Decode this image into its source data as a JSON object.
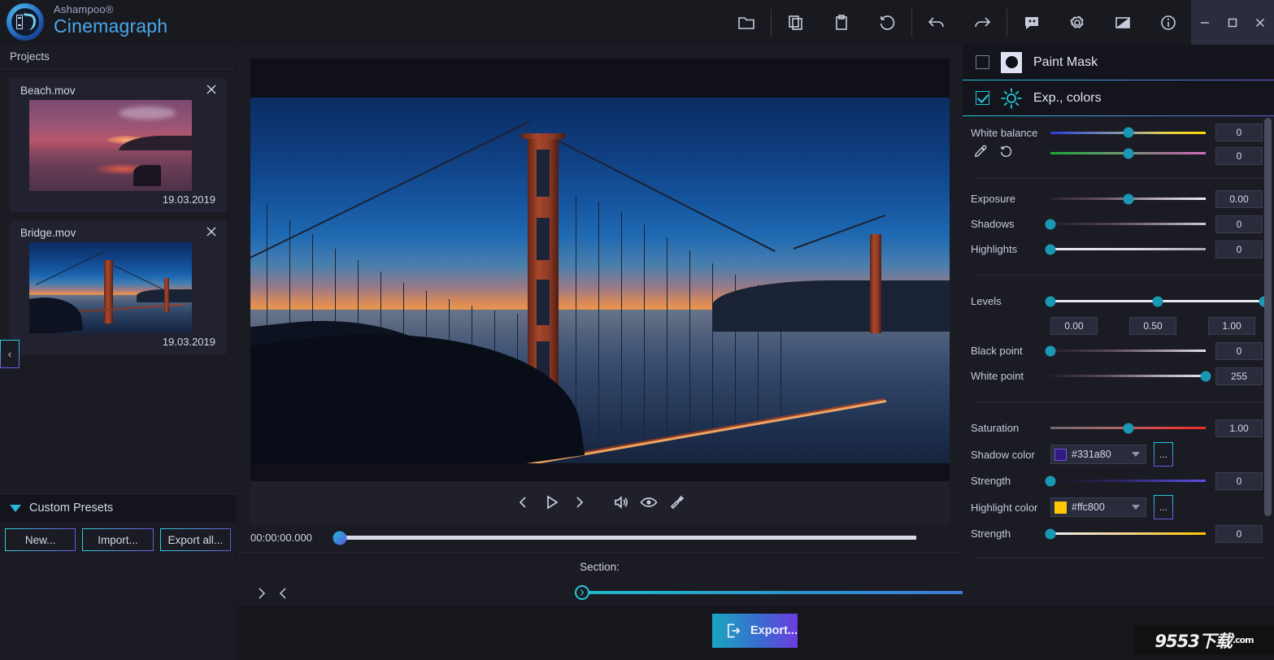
{
  "app": {
    "brand_top": "Ashampoo®",
    "brand_main": "Cinemagraph",
    "logo_icon": "cinemagraph-logo-icon"
  },
  "toolbar": {
    "items": [
      {
        "name": "open-folder-icon",
        "label": "Open"
      },
      {
        "name": "copy-icon",
        "label": "Copy"
      },
      {
        "name": "paste-clipboard-icon",
        "label": "Paste"
      },
      {
        "name": "reset-icon",
        "label": "Reset"
      },
      {
        "name": "undo-icon",
        "label": "Undo"
      },
      {
        "name": "redo-icon",
        "label": "Redo"
      },
      {
        "name": "feedback-icon",
        "label": "Feedback"
      },
      {
        "name": "gear-icon",
        "label": "Settings"
      },
      {
        "name": "theme-contrast-icon",
        "label": "Theme"
      },
      {
        "name": "info-icon",
        "label": "Info"
      }
    ],
    "window": {
      "minimize": "minimize-icon",
      "maximize": "maximize-icon",
      "close": "close-icon"
    }
  },
  "sidebar": {
    "header": "Projects",
    "projects": [
      {
        "name": "Beach.mov",
        "date": "19.03.2019",
        "thumb": "beach-thumbnail"
      },
      {
        "name": "Bridge.mov",
        "date": "19.03.2019",
        "thumb": "bridge-thumbnail"
      }
    ],
    "collapse_glyph": "‹",
    "presets": {
      "title": "Custom Presets",
      "buttons": [
        "New...",
        "Import...",
        "Export all..."
      ]
    }
  },
  "player": {
    "controls": [
      {
        "name": "previous-frame-button",
        "glyph": "prev"
      },
      {
        "name": "play-button",
        "glyph": "play"
      },
      {
        "name": "next-frame-button",
        "glyph": "next"
      },
      {
        "name": "volume-button",
        "glyph": "volume"
      },
      {
        "name": "preview-eye-button",
        "glyph": "eye"
      },
      {
        "name": "tools-wrench-button",
        "glyph": "wrench"
      }
    ],
    "timecode": "00:00:00.000",
    "playhead_pct": 0,
    "section_label": "Section:",
    "section_start_pct": 0,
    "section_end_pct": 100
  },
  "layers": [
    {
      "label": "Paint Mask",
      "checked": false,
      "icon": "paint-mask-icon"
    },
    {
      "label": "Exp., colors",
      "checked": true,
      "icon": "sun-exposure-icon"
    }
  ],
  "adjustments": {
    "white_balance": {
      "label": "White balance",
      "temp_value": "0",
      "temp_pct": 50,
      "tint_value": "0",
      "tint_pct": 50,
      "eyedropper_icon": "eyedropper-icon",
      "reset_icon": "reset-circular-icon"
    },
    "exposure": {
      "label": "Exposure",
      "value": "0.00",
      "pct": 50
    },
    "shadows": {
      "label": "Shadows",
      "value": "0",
      "pct": 0
    },
    "highlights": {
      "label": "Highlights",
      "value": "0",
      "pct": 0
    },
    "levels": {
      "label": "Levels",
      "black": "0.00",
      "black_pct": 0,
      "mid": "0.50",
      "mid_pct": 50,
      "white": "1.00",
      "white_pct": 100
    },
    "black_point": {
      "label": "Black point",
      "value": "0",
      "pct": 0
    },
    "white_point": {
      "label": "White point",
      "value": "255",
      "pct": 100
    },
    "saturation": {
      "label": "Saturation",
      "value": "1.00",
      "pct": 50
    },
    "shadow_color": {
      "label": "Shadow color",
      "value": "#331a80",
      "swatch": "#331a80"
    },
    "shadow_strength": {
      "label": "Strength",
      "value": "0",
      "pct": 0
    },
    "highlight_color": {
      "label": "Highlight color",
      "value": "#ffc800",
      "swatch": "#ffc800"
    },
    "highlight_strength": {
      "label": "Strength",
      "value": "0",
      "pct": 0
    },
    "more_label": "..."
  },
  "footer": {
    "export_label": "Export...",
    "export_icon": "export-arrow-icon",
    "watermark": "9553下载",
    "watermark_domain": ".com"
  },
  "colors": {
    "accent_cyan": "#22c8d8",
    "accent_purple": "#6a5ae0",
    "knob": "#1a97b5",
    "bg_dark": "#16161d",
    "bg_panel": "#1b1b24"
  }
}
